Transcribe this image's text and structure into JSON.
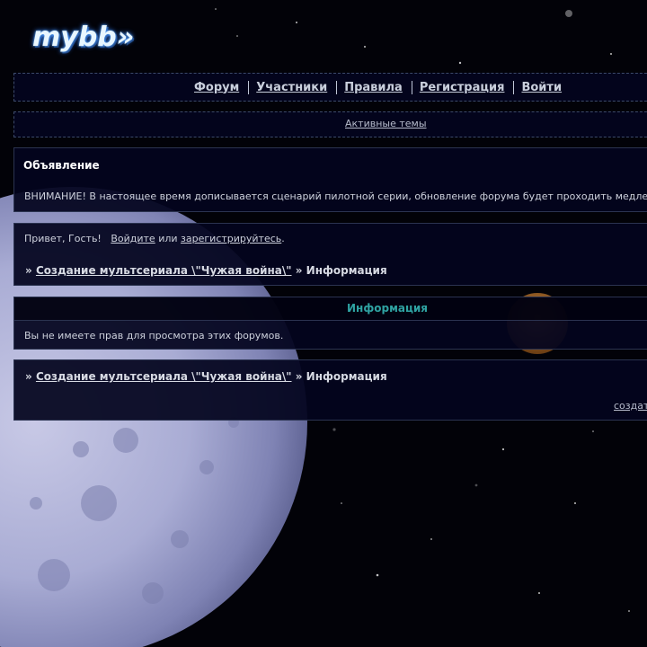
{
  "logo": {
    "text": "mybb»"
  },
  "nav": {
    "items": [
      {
        "label": "Форум"
      },
      {
        "label": "Участники"
      },
      {
        "label": "Правила"
      },
      {
        "label": "Регистрация"
      },
      {
        "label": "Войти"
      }
    ]
  },
  "active_topics": {
    "label": "Активные темы"
  },
  "announcement": {
    "title": "Объявление",
    "text": "ВНИМАНИЕ! В настоящее время дописывается сценарий пилотной серии, обновление форума будет проходить медле"
  },
  "greeting": {
    "prefix": "Привет, Гость!",
    "login_link": "Войдите",
    "or": "или",
    "register_link": "зарегистрируйтесь",
    "suffix": "."
  },
  "breadcrumb": {
    "arrow": "»",
    "forum_link": "Создание мультсериала \\\"Чужая война\\\"",
    "separator": "»",
    "current": "Информация"
  },
  "info": {
    "title": "Информация",
    "message": "Вы не имеете прав для просмотра этих форумов."
  },
  "footer": {
    "create_link": "создат"
  },
  "colors": {
    "panel_bg": "#03041e",
    "info_title": "#2fa3a3",
    "link": "#c9cfdc"
  }
}
